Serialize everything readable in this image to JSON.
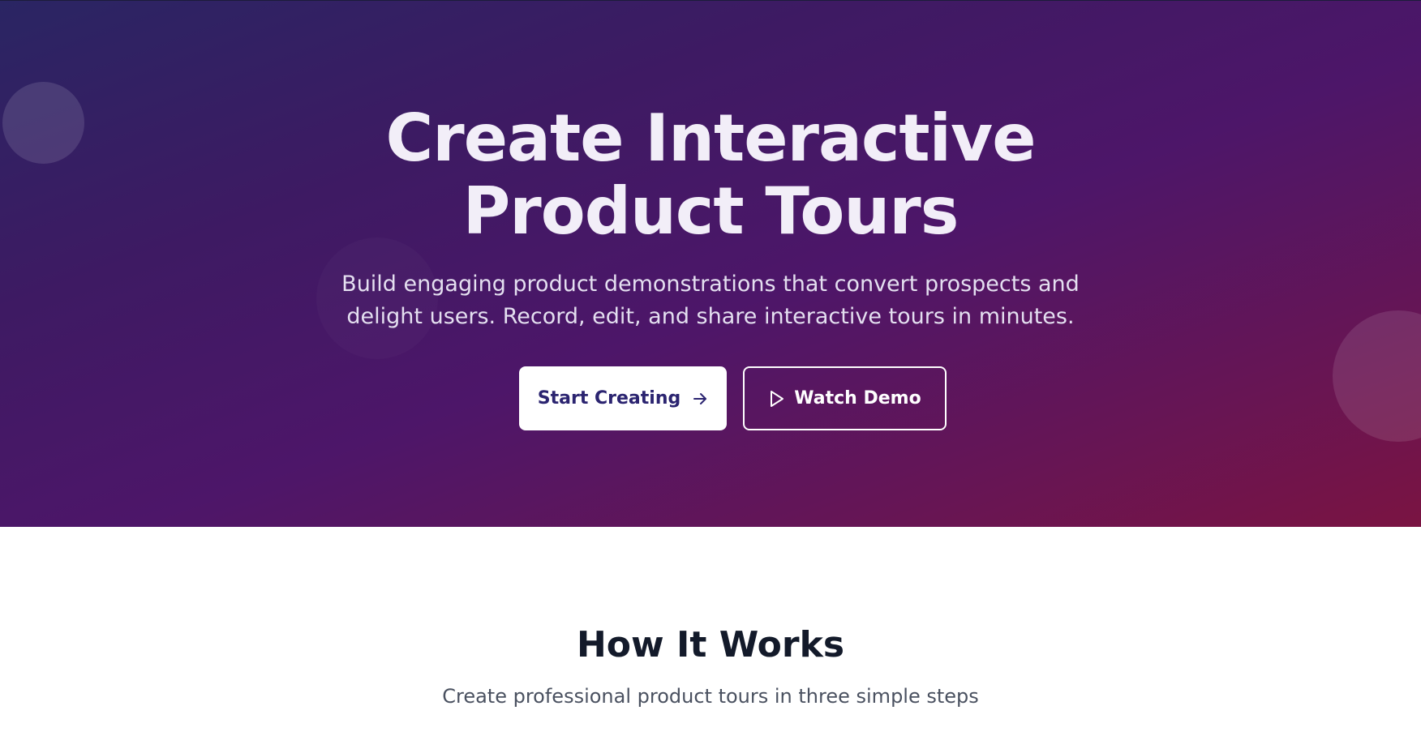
{
  "hero": {
    "title_line1": "Create Interactive",
    "title_line2": "Product Tours",
    "subtitle_line1": "Build engaging product demonstrations that convert prospects and",
    "subtitle_line2": "delight users. Record, edit, and share interactive tours in minutes.",
    "primary_button": {
      "label": "Start Creating",
      "icon": "arrow-right-icon"
    },
    "secondary_button": {
      "label": "Watch Demo",
      "icon": "play-icon"
    }
  },
  "how_it_works": {
    "title": "How It Works",
    "subtitle": "Create professional product tours in three simple steps"
  },
  "colors": {
    "hero_gradient_start": "#2a2563",
    "hero_gradient_end": "#7a1442",
    "primary_button_text": "#2b2470",
    "section_title": "#131a2a"
  }
}
